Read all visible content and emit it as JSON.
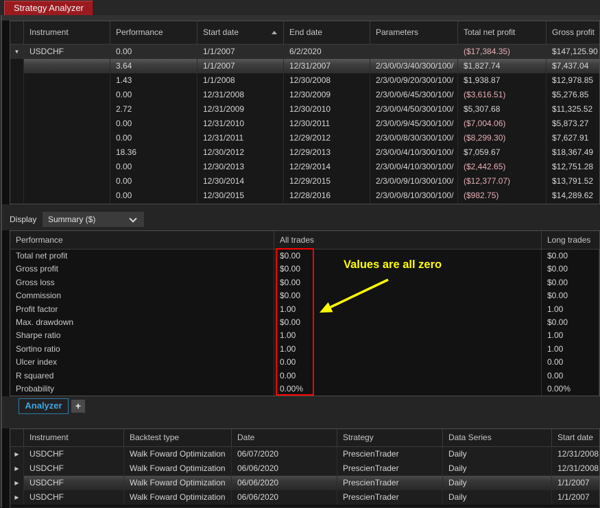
{
  "window": {
    "title_tab": "Strategy Analyzer"
  },
  "top_table": {
    "columns": [
      "Instrument",
      "Performance",
      "Start date",
      "End date",
      "Parameters",
      "Total net profit",
      "Gross profit"
    ],
    "sorted_column": "Start date",
    "sort_direction": "ascending",
    "rows": [
      {
        "state": "parent",
        "expander": "expanded",
        "instrument": "USDCHF",
        "performance": "0.00",
        "start_date": "1/1/2007",
        "end_date": "6/2/2020",
        "parameters": "",
        "total_net_profit": "($17,384.35)",
        "gross_profit": "$147,125.90"
      },
      {
        "state": "selected",
        "expander": "",
        "instrument": "",
        "performance": "3.64",
        "start_date": "1/1/2007",
        "end_date": "12/31/2007",
        "parameters": "2/3/0/0/3/40/300/100/",
        "total_net_profit": "$1,827.74",
        "gross_profit": "$7,437.04"
      },
      {
        "state": "",
        "expander": "",
        "instrument": "",
        "performance": "1.43",
        "start_date": "1/1/2008",
        "end_date": "12/30/2008",
        "parameters": "2/3/0/0/9/20/300/100/",
        "total_net_profit": "$1,938.87",
        "gross_profit": "$12,978.85"
      },
      {
        "state": "",
        "expander": "",
        "instrument": "",
        "performance": "0.00",
        "start_date": "12/31/2008",
        "end_date": "12/30/2009",
        "parameters": "2/3/0/0/6/45/300/100/",
        "total_net_profit": "($3,616.51)",
        "gross_profit": "$5,276.85"
      },
      {
        "state": "",
        "expander": "",
        "instrument": "",
        "performance": "2.72",
        "start_date": "12/31/2009",
        "end_date": "12/30/2010",
        "parameters": "2/3/0/0/4/50/300/100/",
        "total_net_profit": "$5,307.68",
        "gross_profit": "$11,325.52"
      },
      {
        "state": "",
        "expander": "",
        "instrument": "",
        "performance": "0.00",
        "start_date": "12/31/2010",
        "end_date": "12/30/2011",
        "parameters": "2/3/0/0/9/45/300/100/",
        "total_net_profit": "($7,004.06)",
        "gross_profit": "$5,873.27"
      },
      {
        "state": "",
        "expander": "",
        "instrument": "",
        "performance": "0.00",
        "start_date": "12/31/2011",
        "end_date": "12/29/2012",
        "parameters": "2/3/0/0/8/30/300/100/",
        "total_net_profit": "($8,299.30)",
        "gross_profit": "$7,627.91"
      },
      {
        "state": "",
        "expander": "",
        "instrument": "",
        "performance": "18.36",
        "start_date": "12/30/2012",
        "end_date": "12/29/2013",
        "parameters": "2/3/0/0/4/10/300/100/",
        "total_net_profit": "$7,059.67",
        "gross_profit": "$18,367.49"
      },
      {
        "state": "",
        "expander": "",
        "instrument": "",
        "performance": "0.00",
        "start_date": "12/30/2013",
        "end_date": "12/29/2014",
        "parameters": "2/3/0/0/4/10/300/100/",
        "total_net_profit": "($2,442.65)",
        "gross_profit": "$12,751.28"
      },
      {
        "state": "",
        "expander": "",
        "instrument": "",
        "performance": "0.00",
        "start_date": "12/30/2014",
        "end_date": "12/29/2015",
        "parameters": "2/3/0/0/9/10/300/100/",
        "total_net_profit": "($12,377.07)",
        "gross_profit": "$13,791.52"
      },
      {
        "state": "",
        "expander": "",
        "instrument": "",
        "performance": "0.00",
        "start_date": "12/30/2015",
        "end_date": "12/28/2016",
        "parameters": "2/3/0/0/8/10/300/100/",
        "total_net_profit": "($982.75)",
        "gross_profit": "$14,289.62"
      }
    ]
  },
  "display_bar": {
    "label": "Display",
    "selected_option": "Summary ($)"
  },
  "summary_table": {
    "columns": [
      "Performance",
      "All trades",
      "Long trades"
    ],
    "rows": [
      {
        "metric": "Total net profit",
        "all_trades": "$0.00",
        "long_trades": "$0.00"
      },
      {
        "metric": "Gross profit",
        "all_trades": "$0.00",
        "long_trades": "$0.00"
      },
      {
        "metric": "Gross loss",
        "all_trades": "$0.00",
        "long_trades": "$0.00"
      },
      {
        "metric": "Commission",
        "all_trades": "$0.00",
        "long_trades": "$0.00"
      },
      {
        "metric": "Profit factor",
        "all_trades": "1.00",
        "long_trades": "1.00"
      },
      {
        "metric": "Max. drawdown",
        "all_trades": "$0.00",
        "long_trades": "$0.00"
      },
      {
        "metric": "Sharpe ratio",
        "all_trades": "1.00",
        "long_trades": "1.00"
      },
      {
        "metric": "Sortino ratio",
        "all_trades": "1.00",
        "long_trades": "1.00"
      },
      {
        "metric": "Ulcer index",
        "all_trades": "0.00",
        "long_trades": "0.00"
      },
      {
        "metric": "R squared",
        "all_trades": "0.00",
        "long_trades": "0.00"
      },
      {
        "metric": "Probability",
        "all_trades": "0.00%",
        "long_trades": "0.00%"
      }
    ]
  },
  "annotation": {
    "note": "Values are all zero",
    "box_color": "#FF0000",
    "text_color": "#FFFF00",
    "arrow_color": "#FFFF00"
  },
  "tabs": {
    "active_tab": "Analyzer",
    "add_tab": "+"
  },
  "bottom_table": {
    "columns": [
      "Instrument",
      "Backtest type",
      "Date",
      "Strategy",
      "Data Series",
      "Start date"
    ],
    "rows": [
      {
        "state": "",
        "expander": "collapsed",
        "instrument": "USDCHF",
        "backtest_type": "Walk Foward Optimization",
        "date": "06/07/2020",
        "strategy": "PrescienTrader",
        "data_series": "Daily",
        "start_date": "12/31/2008"
      },
      {
        "state": "",
        "expander": "collapsed",
        "instrument": "USDCHF",
        "backtest_type": "Walk Foward Optimization",
        "date": "06/06/2020",
        "strategy": "PrescienTrader",
        "data_series": "Daily",
        "start_date": "12/31/2008"
      },
      {
        "state": "selected",
        "expander": "collapsed",
        "instrument": "USDCHF",
        "backtest_type": "Walk Foward Optimization",
        "date": "06/06/2020",
        "strategy": "PrescienTrader",
        "data_series": "Daily",
        "start_date": "1/1/2007"
      },
      {
        "state": "",
        "expander": "collapsed",
        "instrument": "USDCHF",
        "backtest_type": "Walk Foward Optimization",
        "date": "06/06/2020",
        "strategy": "PrescienTrader",
        "data_series": "Daily",
        "start_date": "1/1/2007"
      }
    ]
  },
  "colors": {
    "negative_value": "#E5AFB5",
    "accent_blue": "#41A5E1",
    "title_tab_bg": "#9A1B1F"
  }
}
